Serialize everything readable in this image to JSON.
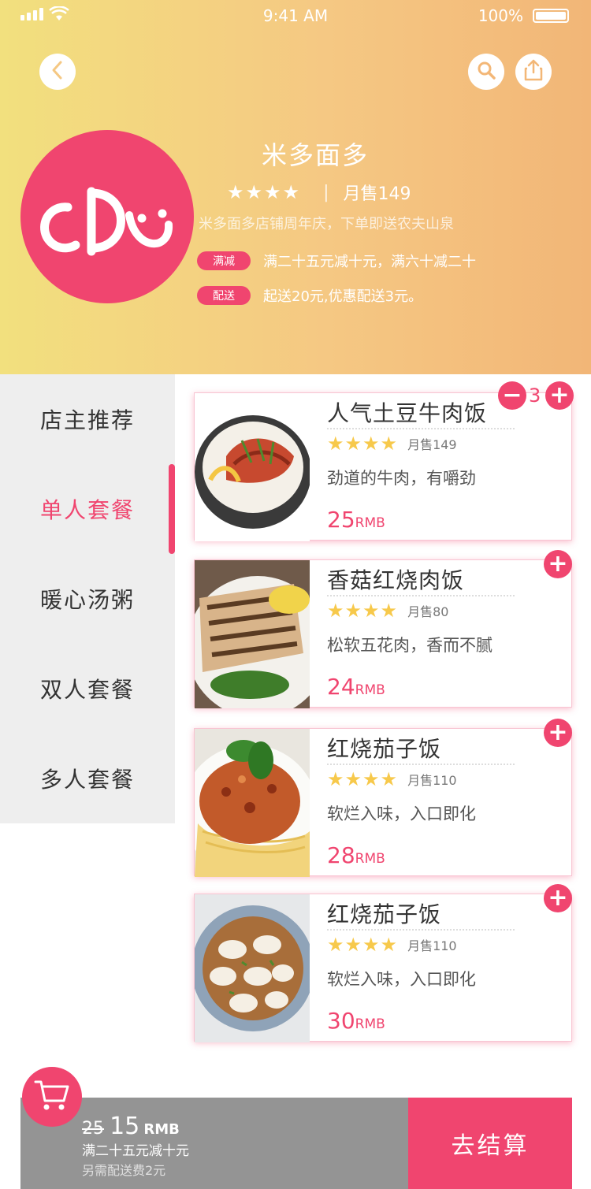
{
  "status_bar": {
    "time": "9:41 AM",
    "battery": "100%"
  },
  "header": {
    "icons": {
      "back": "chevron-left-icon",
      "search": "search-icon",
      "share": "share-icon",
      "logo": "shop-logo"
    },
    "shop_name": "米多面多",
    "rating_stars": "★★★★",
    "monthly_sales": "月售149",
    "notice": "米多面多店铺周年庆，下单即送农夫山泉",
    "promos": [
      {
        "tag": "满减",
        "text": "满二十五元减十元，满六十减二十"
      },
      {
        "tag": "配送",
        "text": "起送20元,优惠配送3元。"
      }
    ]
  },
  "sidebar": {
    "active_index": 1,
    "categories": [
      "店主推荐",
      "单人套餐",
      "暖心汤粥",
      "双人套餐",
      "多人套餐"
    ]
  },
  "dishes": [
    {
      "name": "人气土豆牛肉饭",
      "stars": "★★★★",
      "sales": "月售149",
      "desc": "劲道的牛肉，有嚼劲",
      "price": "25",
      "unit": "RMB",
      "quantity": "3"
    },
    {
      "name": "香菇红烧肉饭",
      "stars": "★★★★",
      "sales": "月售80",
      "desc": "松软五花肉，香而不腻",
      "price": "24",
      "unit": "RMB"
    },
    {
      "name": "红烧茄子饭",
      "stars": "★★★★",
      "sales": "月售110",
      "desc": "软烂入味，入口即化",
      "price": "28",
      "unit": "RMB"
    },
    {
      "name": "红烧茄子饭",
      "stars": "★★★★",
      "sales": "月售110",
      "desc": "软烂入味，入口即化",
      "price": "30",
      "unit": "RMB"
    }
  ],
  "controls": {
    "plus": "+",
    "minus": "−"
  },
  "cart": {
    "icon": "cart-icon",
    "old_price": "25",
    "new_price": "15",
    "unit": "RMB",
    "discount": "满二十五元减十元",
    "delivery_fee": "另需配送费2元",
    "checkout_label": "去结算"
  },
  "colors": {
    "accent": "#f0456f",
    "star": "#f7c94b",
    "sidebar_bg": "#eeeeee",
    "cart_bg": "#949494"
  }
}
